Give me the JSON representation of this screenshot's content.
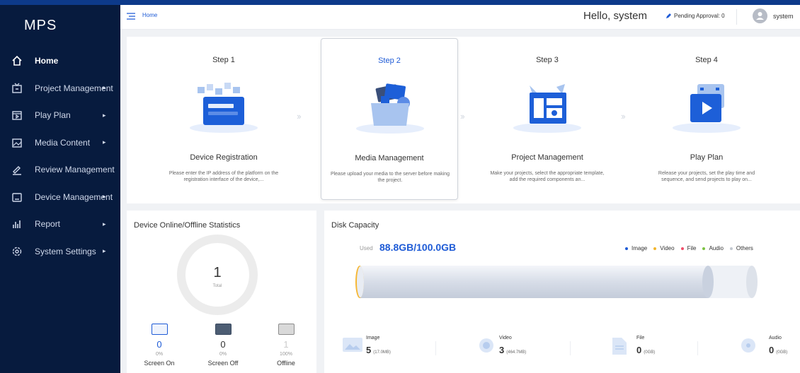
{
  "app": {
    "title": "MPS"
  },
  "colors": {
    "accent": "#1e5bd6",
    "sidebar_bg": "#071b3e",
    "image": "#1e5bd6",
    "video": "#f2b52b",
    "file": "#f04e6a",
    "audio": "#7cc242",
    "others": "#c2c7cf"
  },
  "sidebar": {
    "items": [
      {
        "label": "Home",
        "icon": "home-icon",
        "has_arrow": false
      },
      {
        "label": "Project Management",
        "icon": "project-icon",
        "has_arrow": true
      },
      {
        "label": "Play Plan",
        "icon": "play-plan-icon",
        "has_arrow": true
      },
      {
        "label": "Media Content",
        "icon": "media-icon",
        "has_arrow": true
      },
      {
        "label": "Review Management",
        "icon": "review-icon",
        "has_arrow": false
      },
      {
        "label": "Device Management",
        "icon": "device-icon",
        "has_arrow": true
      },
      {
        "label": "Report",
        "icon": "report-icon",
        "has_arrow": true
      },
      {
        "label": "System Settings",
        "icon": "settings-icon",
        "has_arrow": true
      }
    ]
  },
  "header": {
    "breadcrumb": "Home",
    "greeting": "Hello, system",
    "pending": "Pending Approval: 0",
    "username": "system"
  },
  "steps": [
    {
      "num": "Step 1",
      "title": "Device Registration",
      "desc": "Please enter the IP address of the platform on the registration interface of the device,..."
    },
    {
      "num": "Step 2",
      "title": "Media Management",
      "desc": "Please upload your media to the server before making the project."
    },
    {
      "num": "Step 3",
      "title": "Project Management",
      "desc": "Make your projects, select the appropriate template, add the required components an..."
    },
    {
      "num": "Step 4",
      "title": "Play Plan",
      "desc": "Release your projects, set the play time and sequence, and send projects to play on..."
    }
  ],
  "device_stats": {
    "title": "Device Online/Offline Statistics",
    "total": "1",
    "total_label": "Total",
    "items": [
      {
        "count": "0",
        "pct": "0%",
        "label": "Screen On"
      },
      {
        "count": "0",
        "pct": "0%",
        "label": "Screen Off"
      },
      {
        "count": "1",
        "pct": "100%",
        "label": "Offline"
      }
    ]
  },
  "disk": {
    "title": "Disk Capacity",
    "used_label": "Used",
    "used_value": "88.8GB/100.0GB",
    "used_fraction": 0.888,
    "legend": [
      "Image",
      "Video",
      "File",
      "Audio",
      "Others"
    ],
    "files": [
      {
        "label": "Image",
        "count": "5",
        "size": "(17.0MB)",
        "icon": "image-file-icon"
      },
      {
        "label": "Video",
        "count": "3",
        "size": "(464.7MB)",
        "icon": "video-file-icon"
      },
      {
        "label": "File",
        "count": "0",
        "size": "(0GB)",
        "icon": "document-file-icon"
      },
      {
        "label": "Audio",
        "count": "0",
        "size": "(0GB)",
        "icon": "audio-file-icon"
      }
    ]
  }
}
